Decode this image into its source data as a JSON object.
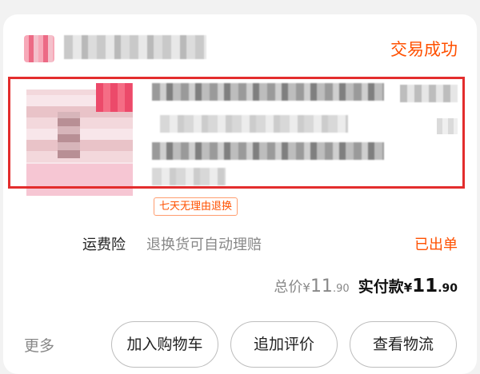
{
  "order": {
    "status": "交易成功"
  },
  "item": {
    "service_tag": "七天无理由退换"
  },
  "insurance": {
    "label": "运费险",
    "description": "退换货可自动理赔",
    "status": "已出单"
  },
  "totals": {
    "total_label": "总价",
    "total_currency": "¥",
    "total_int": "11",
    "total_dec": ".90",
    "paid_label": "实付款",
    "paid_currency": "¥",
    "paid_int": "11",
    "paid_dec": ".90"
  },
  "actions": {
    "more_label": "更多",
    "buttons": [
      "加入购物车",
      "追加评价",
      "查看物流"
    ]
  },
  "colors": {
    "accent": "#ff5000",
    "highlight_border": "#e32d2d"
  }
}
